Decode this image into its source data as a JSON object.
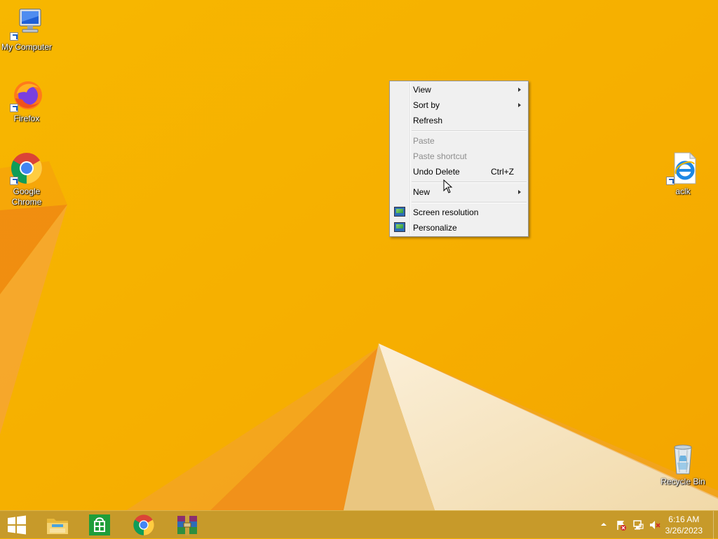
{
  "desktop_icons": [
    {
      "id": "my-computer",
      "label": "My Computer"
    },
    {
      "id": "firefox",
      "label": "Firefox"
    },
    {
      "id": "google-chrome",
      "label": "Google\nChrome"
    },
    {
      "id": "aclk",
      "label": "aclk"
    },
    {
      "id": "recycle-bin",
      "label": "Recycle Bin"
    }
  ],
  "context_menu": {
    "view": "View",
    "sort_by": "Sort by",
    "refresh": "Refresh",
    "paste": "Paste",
    "paste_shortcut": "Paste shortcut",
    "undo_delete": "Undo Delete",
    "undo_delete_shortcut": "Ctrl+Z",
    "new": "New",
    "screen_resolution": "Screen resolution",
    "personalize": "Personalize"
  },
  "taskbar": {
    "pinned": [
      "start-button",
      "file-explorer",
      "store",
      "google-chrome",
      "winrar"
    ]
  },
  "clock": {
    "time": "6:16 AM",
    "date": "3/26/2023"
  },
  "colors": {
    "wallpaper": "#F6B000",
    "taskbar": "#C79A2A",
    "menu_bg": "#F0F0F0"
  }
}
